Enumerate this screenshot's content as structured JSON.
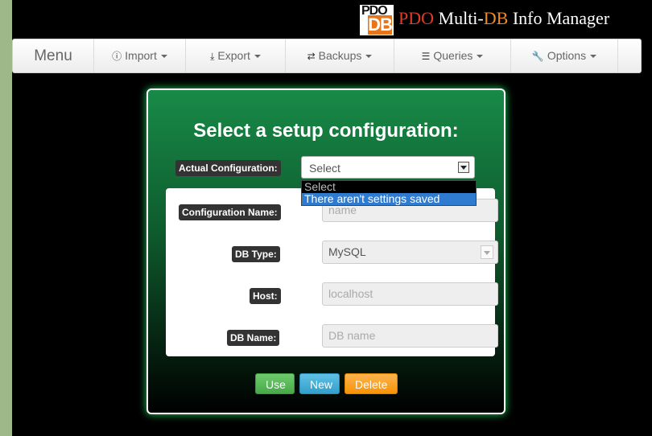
{
  "header": {
    "logo": {
      "top_text": "PDO",
      "bottom_text": "DB"
    },
    "title_parts": {
      "pdo": "PDO",
      "multi": " Multi-",
      "db": "DB",
      "rest": " Info Manager"
    }
  },
  "navbar": {
    "brand": "Menu",
    "items": [
      {
        "icon": "info-circle-icon",
        "glyph": "ⓘ",
        "label": "Import"
      },
      {
        "icon": "download-icon",
        "glyph": "⤓",
        "label": "Export"
      },
      {
        "icon": "retweet-icon",
        "glyph": "⇄",
        "label": "Backups"
      },
      {
        "icon": "list-alt-icon",
        "glyph": "☰",
        "label": "Queries"
      },
      {
        "icon": "wrench-icon",
        "glyph": "🔧",
        "label": "Options"
      }
    ]
  },
  "panel": {
    "title": "Select a setup configuration:",
    "actual_config": {
      "label": "Actual Configuration:",
      "selected": "Select",
      "options": [
        "Select",
        "There aren't settings saved"
      ],
      "highlighted_option": "There aren't settings saved"
    },
    "form": {
      "config_name": {
        "label": "Configuration Name:",
        "placeholder": "name"
      },
      "db_type": {
        "label": "DB Type:",
        "value": "MySQL"
      },
      "host": {
        "label": "Host:",
        "placeholder": "localhost"
      },
      "db_name": {
        "label": "DB Name:",
        "placeholder": "DB name"
      }
    },
    "buttons": {
      "use": "Use",
      "new": "New",
      "delete": "Delete"
    }
  },
  "colors": {
    "panel_green": "#188a48",
    "glow": "#1ed35a",
    "use_btn": "#5cb85c",
    "new_btn": "#5bc0de",
    "delete_btn": "#f89406",
    "highlight": "#2f7bd0"
  }
}
